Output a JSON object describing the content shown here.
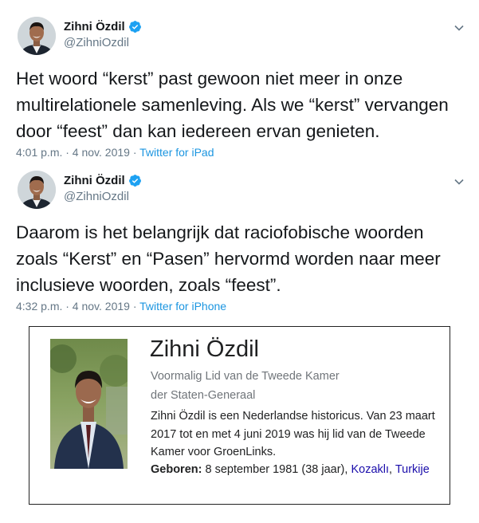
{
  "tweets": [
    {
      "display_name": "Zihni Özdil",
      "handle": "@ZihniOzdil",
      "text": "Het woord “kerst” past gewoon niet meer in onze\nmultirelationele samenleving. Als we “kerst” vervangen\ndoor “feest” dan kan iedereen ervan genieten.",
      "time": "4:01 p.m. · 4 nov. 2019 · ",
      "source": "Twitter for iPad"
    },
    {
      "display_name": "Zihni Özdil",
      "handle": "@ZihniOzdil",
      "text": "Daarom is het belangrijk dat raciofobische woorden\nzoals “Kerst” en “Pasen” hervormd worden naar meer\ninclusieve woorden, zoals “feest”.",
      "time": "4:32 p.m. · 4 nov. 2019 · ",
      "source": "Twitter for iPhone"
    }
  ],
  "wiki": {
    "title": "Zihni Özdil",
    "subtitle": "Voormalig Lid van de Tweede Kamer der Staten-Generaal",
    "description": "Zihni Özdil is een Nederlandse historicus. Van 23 maart 2017 tot en met 4 juni 2019 was hij lid van de Tweede Kamer voor GroenLinks.",
    "born_label": "Geboren:",
    "born_value": " 8 september 1981 (38 jaar), ",
    "born_place": "Kozaklı",
    "born_sep": ", ",
    "born_country": "Turkije"
  },
  "colors": {
    "verified": "#1da1f2",
    "link": "#1b95e0",
    "muted": "#657786"
  },
  "icons": {
    "verified": "verified-badge-icon",
    "chevron": "chevron-down-icon"
  }
}
